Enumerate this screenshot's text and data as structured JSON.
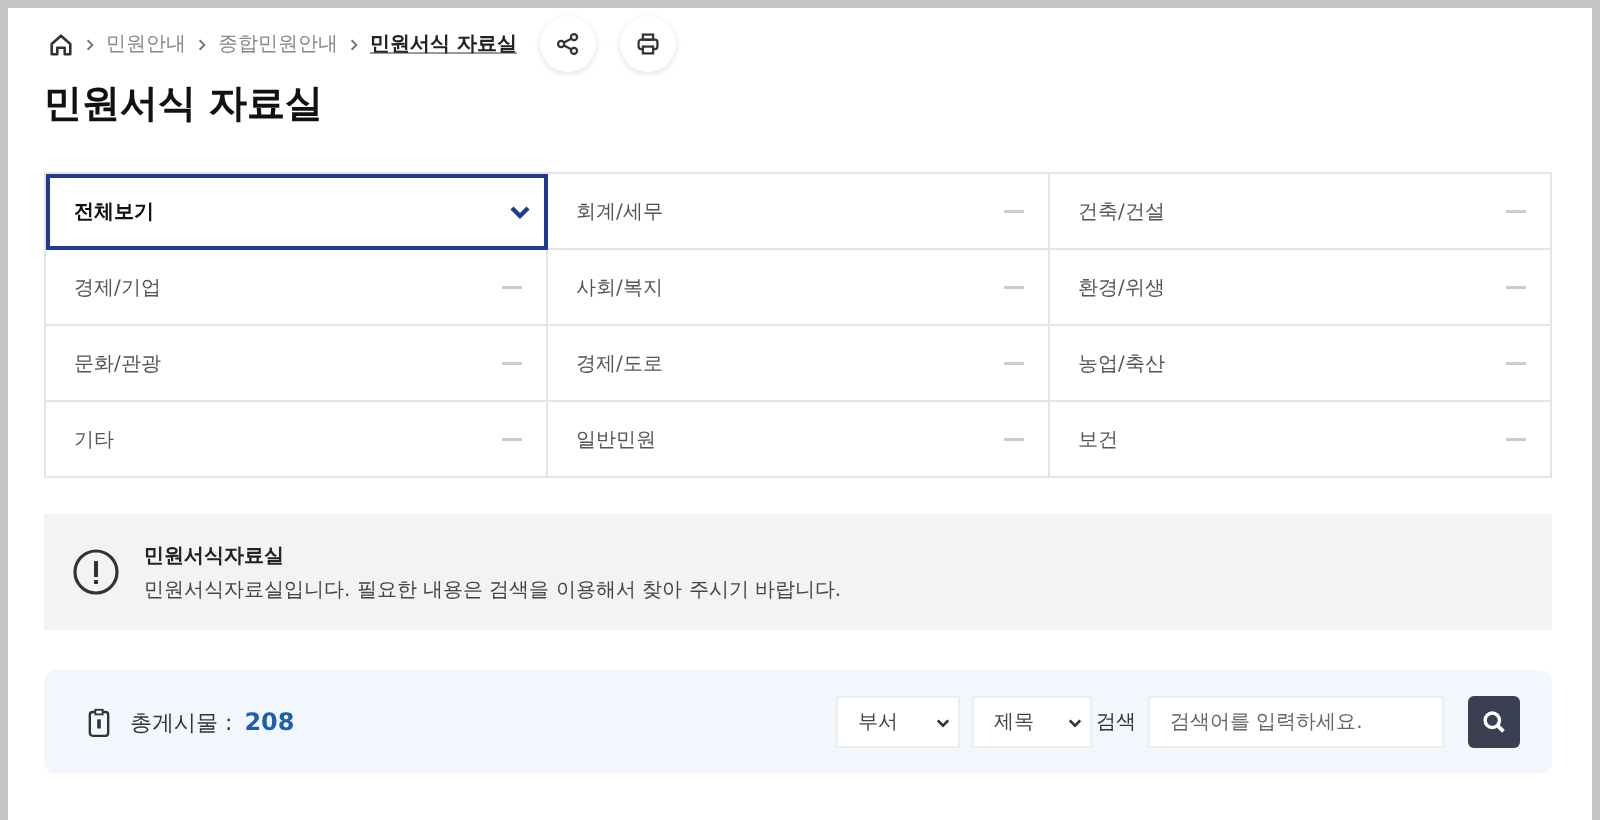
{
  "breadcrumb": {
    "items": [
      {
        "label": "민원안내",
        "current": false
      },
      {
        "label": "종합민원안내",
        "current": false
      },
      {
        "label": "민원서식 자료실",
        "current": true
      }
    ]
  },
  "title": "민원서식 자료실",
  "categories": [
    {
      "label": "전체보기",
      "selected": true
    },
    {
      "label": "회계/세무",
      "selected": false
    },
    {
      "label": "건축/건설",
      "selected": false
    },
    {
      "label": "경제/기업",
      "selected": false
    },
    {
      "label": "사회/복지",
      "selected": false
    },
    {
      "label": "환경/위생",
      "selected": false
    },
    {
      "label": "문화/관광",
      "selected": false
    },
    {
      "label": "경제/도로",
      "selected": false
    },
    {
      "label": "농업/축산",
      "selected": false
    },
    {
      "label": "기타",
      "selected": false
    },
    {
      "label": "일반민원",
      "selected": false
    },
    {
      "label": "보건",
      "selected": false
    }
  ],
  "notice": {
    "title": "민원서식자료실",
    "text": "민원서식자료실입니다. 필요한 내용은 검색을 이용해서 찾아 주시기 바랍니다."
  },
  "search_bar": {
    "count_label": "총게시물 :",
    "count": "208",
    "select_1": "부서",
    "select_2": "제목",
    "search_label": "검색",
    "placeholder": "검색어를 입력하세요."
  }
}
